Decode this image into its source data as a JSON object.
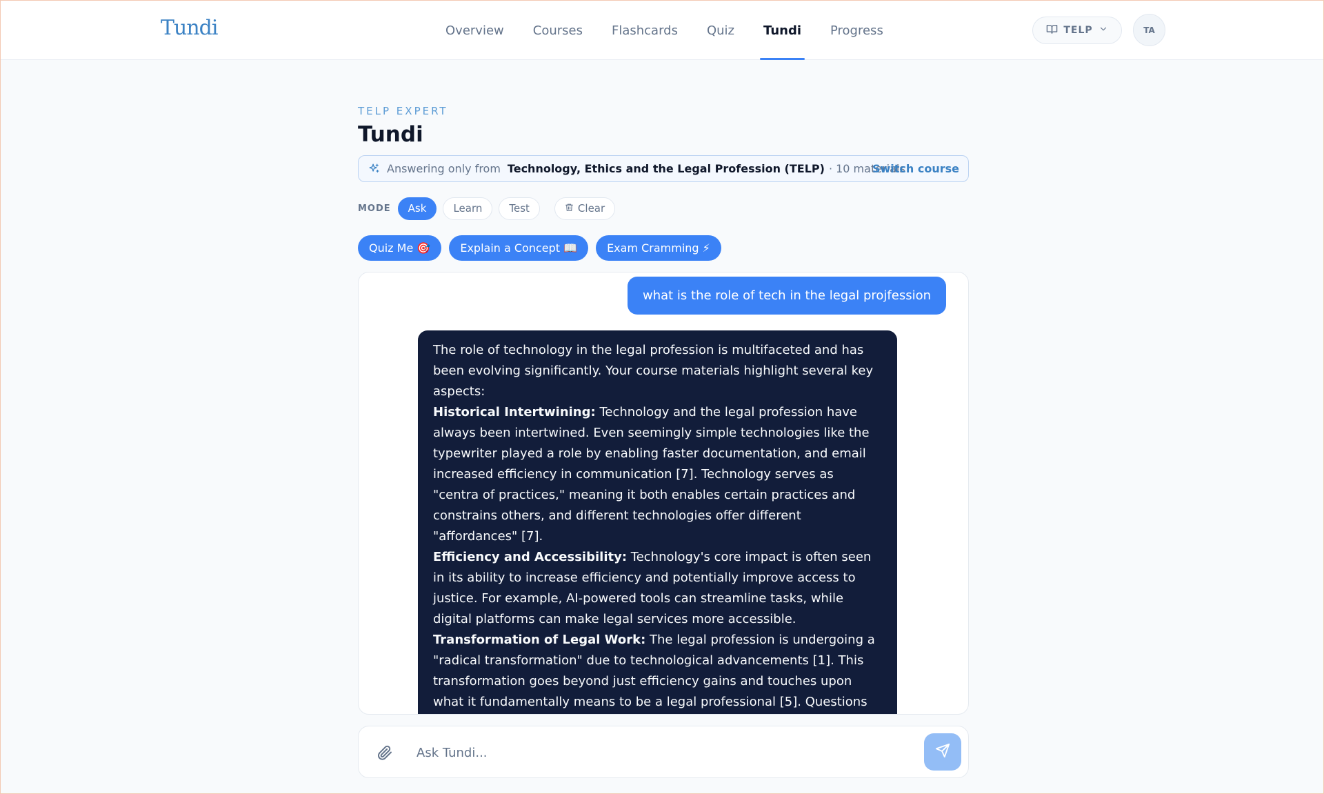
{
  "header": {
    "logo": "Tundi",
    "nav": [
      {
        "label": "Overview",
        "active": false
      },
      {
        "label": "Courses",
        "active": false
      },
      {
        "label": "Flashcards",
        "active": false
      },
      {
        "label": "Quiz",
        "active": false
      },
      {
        "label": "Tundi",
        "active": true
      },
      {
        "label": "Progress",
        "active": false
      }
    ],
    "course_selector": {
      "label": "TELP",
      "icon": "book-icon",
      "chevron": "chevron-down-icon"
    },
    "avatar_initials": "TA"
  },
  "page": {
    "eyebrow": "TELP EXPERT",
    "title": "Tundi"
  },
  "scope": {
    "icon": "sparkle-icon",
    "prefix": "Answering only from",
    "course_name": "Technology, Ethics and the Legal Profession (TELP)",
    "materials": "· 10 materials",
    "switch_label": "Switch course"
  },
  "mode": {
    "label": "MODE",
    "options": [
      {
        "label": "Ask",
        "active": true
      },
      {
        "label": "Learn",
        "active": false
      },
      {
        "label": "Test",
        "active": false
      }
    ],
    "clear_label": "Clear",
    "clear_icon": "trash-icon"
  },
  "quick_actions": [
    {
      "label": "Quiz Me 🎯"
    },
    {
      "label": "Explain a Concept 📖"
    },
    {
      "label": "Exam Cramming ⚡"
    }
  ],
  "chat": {
    "user_message": "what is the role of tech in the legal projfession",
    "assistant": {
      "intro": "The role of technology in the legal profession is multifaceted and has been evolving significantly. Your course materials highlight several key aspects:",
      "points": [
        {
          "heading": "Historical Intertwining:",
          "text": " Technology and the legal profession have always been intertwined. Even seemingly simple technologies like the typewriter played a role by enabling faster documentation, and email increased efficiency in communication [7]. Technology serves as \"centra of practices,\" meaning it both enables certain practices and constrains others, and different technologies offer different \"affordances\" [7]."
        },
        {
          "heading": "Efficiency and Accessibility:",
          "text": " Technology's core impact is often seen in its ability to increase efficiency and potentially improve access to justice. For example, AI-powered tools can streamline tasks, while digital platforms can make legal services more accessible."
        },
        {
          "heading": "Transformation of Legal Work:",
          "text": " The legal profession is undergoing a \"radical transformation\" due to technological advancements [1]. This transformation goes beyond just efficiency gains and touches upon what it fundamentally means to be a legal professional [5]. Questions arise about whether there's an \"essence\" to the legal profession, a"
        }
      ]
    }
  },
  "composer": {
    "placeholder": "Ask Tundi...",
    "attach_icon": "paperclip-icon",
    "send_icon": "send-icon"
  },
  "colors": {
    "accent": "#3b82f6",
    "assistant_bubble": "#121d3a",
    "logo": "#3b82c4"
  }
}
